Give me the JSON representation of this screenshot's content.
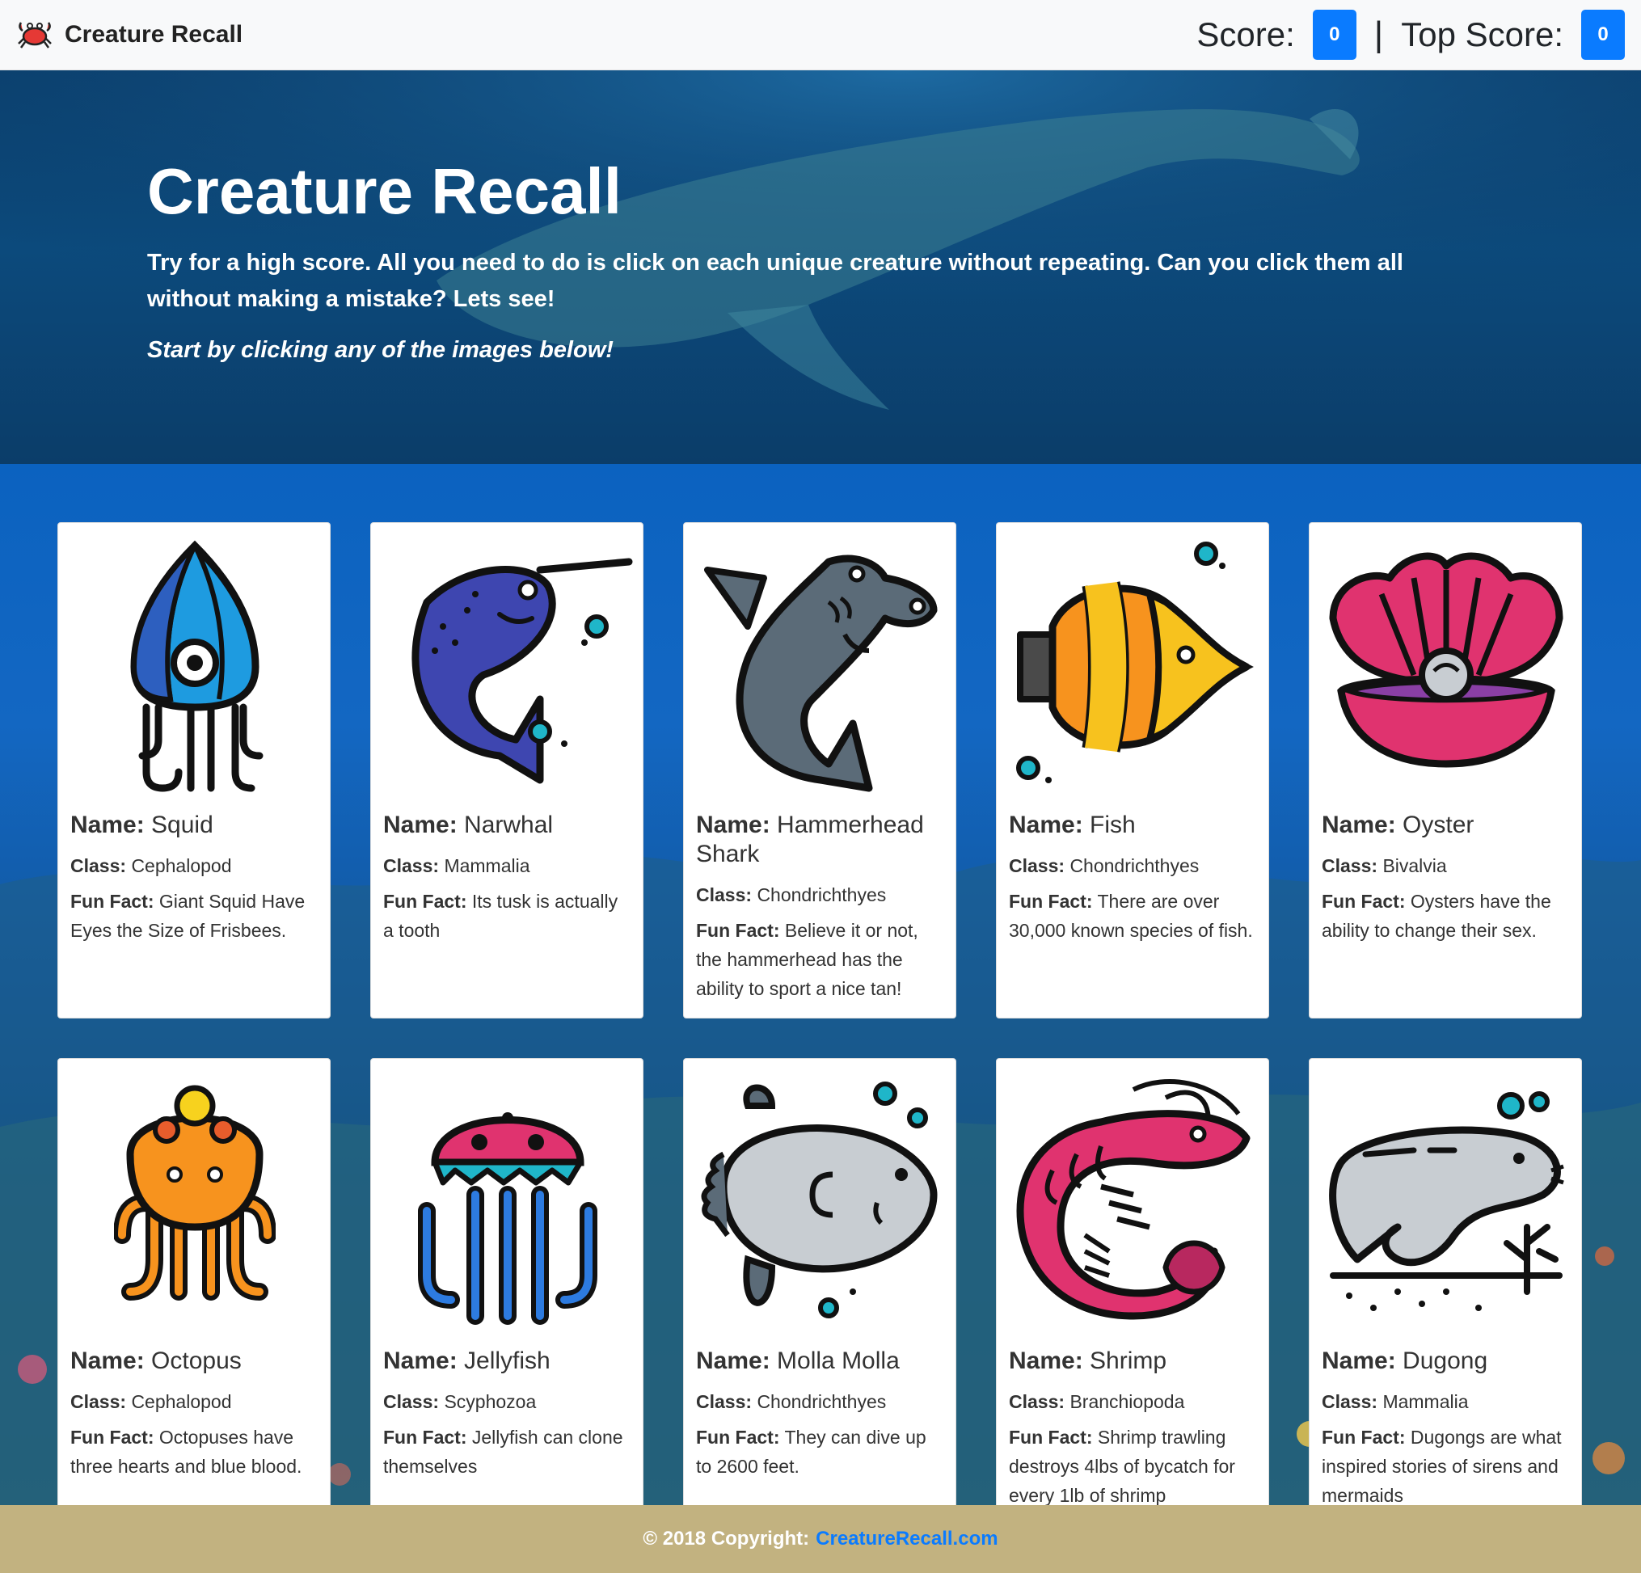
{
  "navbar": {
    "brand": "Creature Recall",
    "brand_icon": "crab-icon",
    "score_label": "Score:",
    "score_value": "0",
    "divider": "|",
    "top_score_label": "Top Score:",
    "top_score_value": "0"
  },
  "hero": {
    "title": "Creature Recall",
    "lead": "Try for a high score. All you need to do is click on each unique creature without repeating. Can you click them all without making a mistake? Lets see!",
    "cta": "Start by clicking any of the images below!"
  },
  "labels": {
    "name": "Name:",
    "class": "Class:",
    "fact": "Fun Fact:"
  },
  "cards": [
    {
      "icon": "squid-icon",
      "name": "Squid",
      "class": "Cephalopod",
      "fact": "Giant Squid Have Eyes the Size of Frisbees."
    },
    {
      "icon": "narwhal-icon",
      "name": "Narwhal",
      "class": "Mammalia",
      "fact": "Its tusk is actually a tooth"
    },
    {
      "icon": "hammerhead-shark-icon",
      "name": "Hammerhead Shark",
      "class": "Chondrichthyes",
      "fact": "Believe it or not, the hammerhead has the ability to sport a nice tan!"
    },
    {
      "icon": "fish-icon",
      "name": "Fish",
      "class": "Chondrichthyes",
      "fact": "There are over 30,000 known species of fish."
    },
    {
      "icon": "oyster-icon",
      "name": "Oyster",
      "class": "Bivalvia",
      "fact": "Oysters have the ability to change their sex."
    },
    {
      "icon": "octopus-icon",
      "name": "Octopus",
      "class": "Cephalopod",
      "fact": "Octopuses have three hearts and blue blood."
    },
    {
      "icon": "jellyfish-icon",
      "name": "Jellyfish",
      "class": "Scyphozoa",
      "fact": "Jellyfish can clone themselves"
    },
    {
      "icon": "molla-molla-icon",
      "name": "Molla Molla",
      "class": "Chondrichthyes",
      "fact": "They can dive up to 2600 feet."
    },
    {
      "icon": "shrimp-icon",
      "name": "Shrimp",
      "class": "Branchiopoda",
      "fact": "Shrimp trawling destroys 4lbs of bycatch for every 1lb of shrimp"
    },
    {
      "icon": "dugong-icon",
      "name": "Dugong",
      "class": "Mammalia",
      "fact": "Dugongs are what inspired stories of sirens and mermaids"
    }
  ],
  "footer": {
    "copyright": "© 2018 Copyright:",
    "link": "CreatureRecall.com"
  },
  "colors": {
    "navbar_bg": "#f8f9fa",
    "badge": "#0a7bff",
    "footer_bg": "#c2b280",
    "link": "#0a7bff"
  }
}
